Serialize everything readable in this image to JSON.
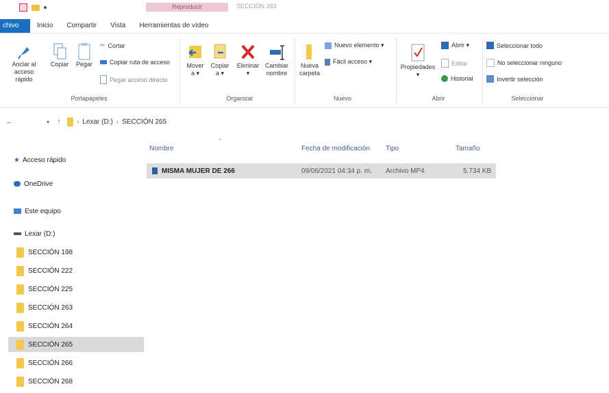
{
  "window": {
    "contextual_tab_label": "Reproducir",
    "title": "SECCIÓN 263"
  },
  "tabs": [
    {
      "label": "chivo"
    },
    {
      "label": "Inicio"
    },
    {
      "label": "Compartir"
    },
    {
      "label": "Vista"
    },
    {
      "label": "Herramientas de vídeo"
    }
  ],
  "ribbon": {
    "portapapeles": {
      "label": "Portapapeles",
      "anclar": [
        "Anclar al",
        "acceso rápido"
      ],
      "copiar": "Copiar",
      "pegar": "Pegar",
      "cortar": "Cortar",
      "copiar_ruta": "Copiar ruta de acceso",
      "pegar_acceso": "Pegar acceso directo"
    },
    "organizar": {
      "label": "Organizar",
      "mover": [
        "Mover",
        "a ▾"
      ],
      "copiar": [
        "Copiar",
        "a ▾"
      ],
      "eliminar": [
        "Eliminar",
        "▾"
      ],
      "cambiar": [
        "Cambiar",
        "nombre"
      ]
    },
    "nuevo": {
      "label": "Nuevo",
      "nueva_carpeta": [
        "Nueva",
        "carpeta"
      ],
      "nuevo_elemento": "Nuevo elemento ▾",
      "facil_acceso": "Fácil acceso ▾"
    },
    "abrir": {
      "label": "Abrir",
      "propiedades": [
        "Propiedades",
        "▾"
      ],
      "abrir": "Abrir ▾",
      "editar": "Editar",
      "historial": "Historial"
    },
    "seleccionar": {
      "label": "Seleccionar",
      "todo": "Seleccionar todo",
      "ninguno": "No seleccionar ninguno",
      "invertir": "Invertir selección"
    }
  },
  "address": {
    "drive": "Lexar (D:)",
    "folder": "SECCIÓN 265"
  },
  "nav": {
    "quick_access": "Acceso rápido",
    "onedrive": "OneDrive",
    "this_pc": "Este equipo",
    "drive": "Lexar (D:)",
    "folders": [
      "SECCIÓN 198",
      "SECCIÓN 222",
      "SECCIÓN 225",
      "SECCIÓN 263",
      "SECCIÓN 264",
      "SECCIÓN 265",
      "SECCIÓN 266",
      "SECCIÓN 268"
    ],
    "selected_index": 5
  },
  "columns": {
    "name": "Nombre",
    "modified": "Fecha de modificación",
    "type": "Tipo",
    "size": "Tamaño"
  },
  "files": [
    {
      "name": "MISMA MUJER DE 266",
      "modified": "09/06/2021 04:34 p. m.",
      "type": "Archivo MP4",
      "size": "5.734 KB"
    }
  ],
  "colors": {
    "accent": "#1a6fc4",
    "folder": "#f2c94c",
    "selection": "#dedede"
  }
}
